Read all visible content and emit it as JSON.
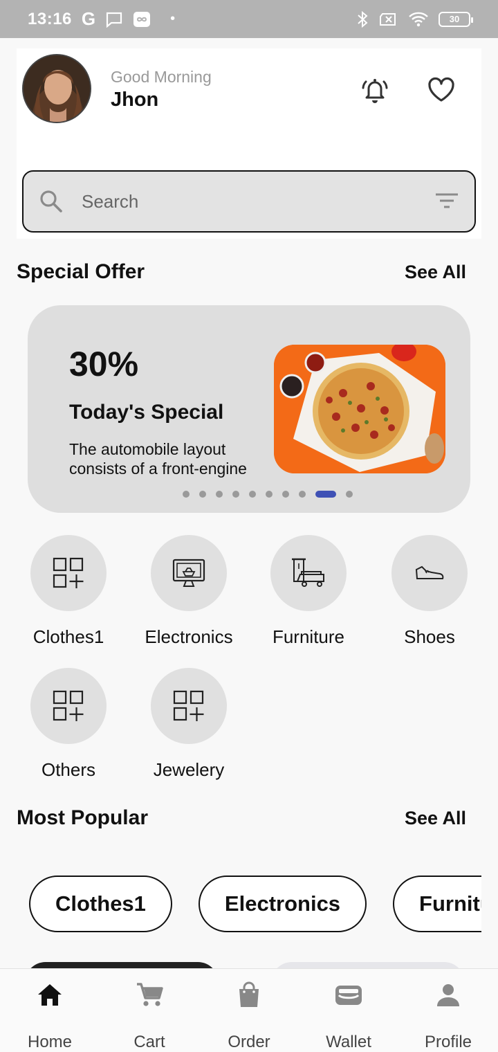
{
  "status_bar": {
    "time": "13:16",
    "g_label": "G",
    "battery": "30",
    "icons": [
      "message-icon",
      "infinity-icon",
      "bluetooth-icon",
      "sim-icon",
      "wifi-icon",
      "battery-icon"
    ]
  },
  "header": {
    "greeting": "Good Morning",
    "user_name": "Jhon"
  },
  "search": {
    "placeholder": "Search"
  },
  "special_offer": {
    "title": "Special Offer",
    "see_all": "See All",
    "banner": {
      "percent": "30%",
      "title": "Today's Special",
      "description": "The automobile layout consists of a front-engine",
      "dots_count": 10,
      "active_dot_index": 8
    }
  },
  "categories": [
    {
      "label": "Clothes1",
      "icon": "category-grid-icon"
    },
    {
      "label": "Electronics",
      "icon": "monitor-icon"
    },
    {
      "label": "Furniture",
      "icon": "furniture-icon"
    },
    {
      "label": "Shoes",
      "icon": "shoe-icon"
    },
    {
      "label": "Others",
      "icon": "category-grid-icon"
    },
    {
      "label": "Jewelery",
      "icon": "category-grid-icon"
    }
  ],
  "most_popular": {
    "title": "Most Popular",
    "see_all": "See All",
    "chips": [
      "Clothes1",
      "Electronics",
      "Furniture"
    ]
  },
  "bottom_nav": [
    {
      "label": "Home",
      "icon": "home-icon",
      "active": true
    },
    {
      "label": "Cart",
      "icon": "cart-icon",
      "active": false
    },
    {
      "label": "Order",
      "icon": "bag-icon",
      "active": false
    },
    {
      "label": "Wallet",
      "icon": "wallet-icon",
      "active": false
    },
    {
      "label": "Profile",
      "icon": "person-icon",
      "active": false
    }
  ],
  "colors": {
    "status_bar": "#b3b3b3",
    "accent_dot": "#3f51b5",
    "card_bg": "#dedede",
    "promo_orange": "#f36a17"
  }
}
